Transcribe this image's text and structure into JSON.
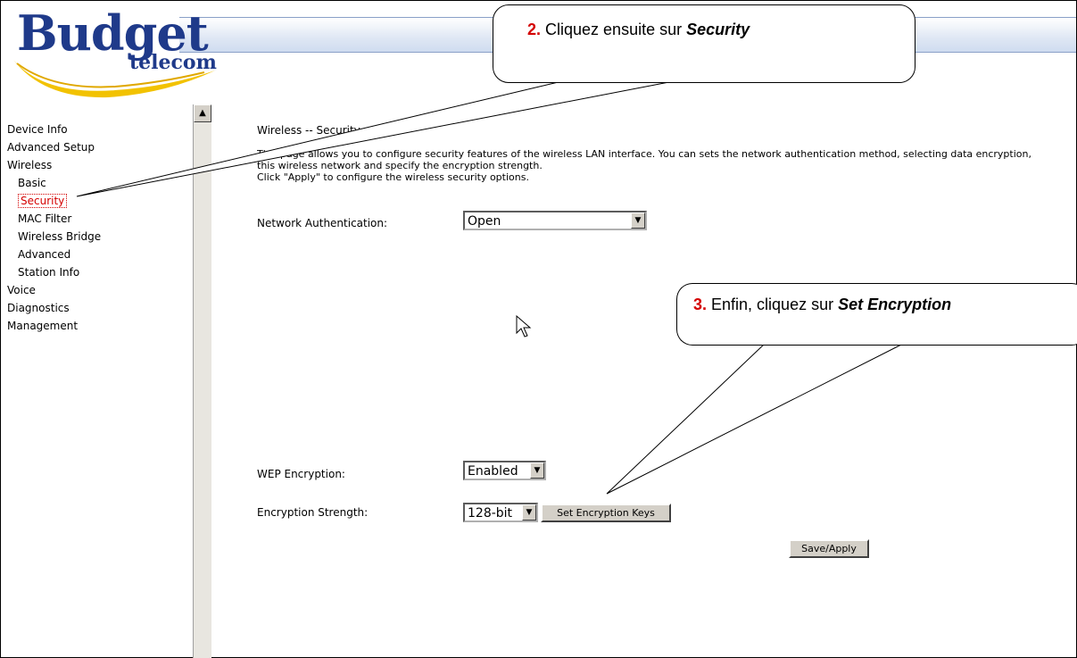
{
  "header": {
    "logo_budget": "Budget",
    "logo_telecom": "telecom"
  },
  "sidebar": {
    "items": [
      {
        "label": "Device Info"
      },
      {
        "label": "Advanced Setup"
      },
      {
        "label": "Wireless"
      },
      {
        "label": "Basic"
      },
      {
        "label": "Security"
      },
      {
        "label": "MAC Filter"
      },
      {
        "label": "Wireless Bridge"
      },
      {
        "label": "Advanced"
      },
      {
        "label": "Station Info"
      },
      {
        "label": "Voice"
      },
      {
        "label": "Diagnostics"
      },
      {
        "label": "Management"
      }
    ],
    "active": "Security"
  },
  "main": {
    "title": "Wireless -- Security",
    "description_line1": "This page allows you to configure security features of the wireless LAN interface. You can sets the network authentication method, selecting data encryption,",
    "description_line2": "this wireless network and specify the encryption strength.",
    "description_line3": "Click \"Apply\" to configure the wireless security options.",
    "network_auth_label": "Network Authentication:",
    "network_auth_value": "Open",
    "wep_label": "WEP Encryption:",
    "wep_value": "Enabled",
    "strength_label": "Encryption Strength:",
    "strength_value": "128-bit",
    "set_keys_button": "Set Encryption Keys",
    "save_button": "Save/Apply"
  },
  "callouts": {
    "c2_num": "2.",
    "c2_text": " Cliquez ensuite sur ",
    "c2_em": "Security",
    "c3_num": "3.",
    "c3_text": " Enfin, cliquez sur ",
    "c3_em": "Set Encryption"
  },
  "colors": {
    "accent_red": "#d40000",
    "logo_blue": "#1f3a8a",
    "logo_swoosh": "#f2c200"
  },
  "icons": [
    "scroll-up-icon",
    "dropdown-arrow-icon",
    "mouse-pointer-icon"
  ]
}
